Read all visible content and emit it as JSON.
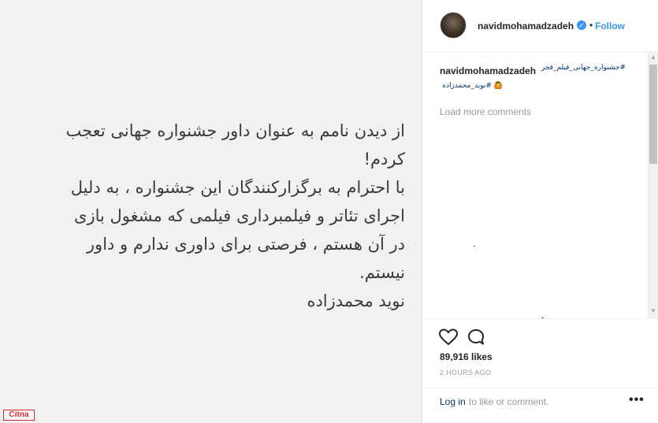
{
  "post_image": {
    "lines": [
      "از دیدن نامم به عنوان داور جشنواره جهانی تعجب",
      "کردم!",
      "با احترام به برگزارکنندگان این جشنواره ، به دلیل",
      "اجرای تئاتر و  فیلمبرداری فیلمی که مشغول بازی",
      "در آن هستم ، فرصتی برای داوری ندارم و داور",
      "نیستم.",
      "نوید محمدزاده"
    ],
    "watermark": "Citna"
  },
  "header": {
    "username": "navidmohamadzadeh",
    "separator": "•",
    "follow_label": "Follow",
    "verified_icon": "verified-badge-icon"
  },
  "caption": {
    "username": "navidmohamadzadeh",
    "hashtag_1": "#جشنواره_جهانی_فیلم_فجر",
    "hashtag_2": "#نوید_محمدزاده",
    "emoji": "🙆"
  },
  "load_more": "Load more comments",
  "actions": {
    "like_icon": "heart-icon",
    "comment_icon": "comment-icon",
    "likes": "89,916 likes",
    "timestamp": "2 HOURS AGO"
  },
  "login": {
    "link": "Log in",
    "rest": "to like or comment.",
    "more": "•••"
  },
  "colors": {
    "link_blue": "#3897f0",
    "hashtag": "#003569",
    "muted": "#999999",
    "text": "#262626"
  }
}
